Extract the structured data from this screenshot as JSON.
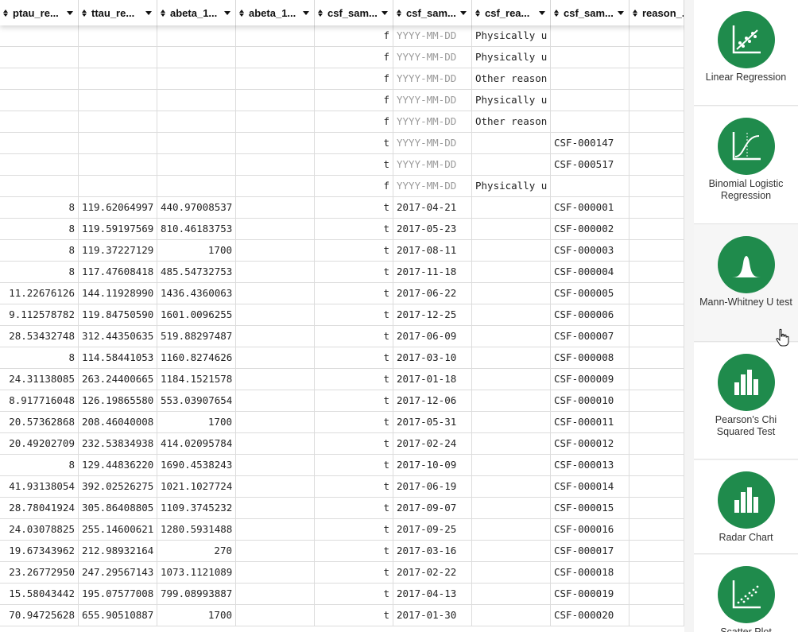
{
  "grid": {
    "columns": [
      {
        "label": "ptau_re..."
      },
      {
        "label": "ttau_re..."
      },
      {
        "label": "abeta_1..."
      },
      {
        "label": "abeta_1..."
      },
      {
        "label": "csf_sam..."
      },
      {
        "label": "csf_sam..."
      },
      {
        "label": "csf_rea..."
      },
      {
        "label": "csf_sam..."
      },
      {
        "label": "reason_..."
      }
    ],
    "date_placeholder": "YYYY-MM-DD",
    "rows": [
      [
        "",
        "",
        "",
        "",
        "f",
        "",
        "Physically u",
        "",
        ""
      ],
      [
        "",
        "",
        "",
        "",
        "f",
        "",
        "Physically u",
        "",
        ""
      ],
      [
        "",
        "",
        "",
        "",
        "f",
        "",
        "Other reason",
        "",
        ""
      ],
      [
        "",
        "",
        "",
        "",
        "f",
        "",
        "Physically u",
        "",
        ""
      ],
      [
        "",
        "",
        "",
        "",
        "f",
        "",
        "Other reason",
        "",
        ""
      ],
      [
        "",
        "",
        "",
        "",
        "t",
        "",
        "",
        "CSF-000147",
        ""
      ],
      [
        "",
        "",
        "",
        "",
        "t",
        "",
        "",
        "CSF-000517",
        ""
      ],
      [
        "",
        "",
        "",
        "",
        "f",
        "",
        "Physically u",
        "",
        ""
      ],
      [
        "8",
        "119.62064997",
        "440.97008537",
        "",
        "t",
        "2017-04-21",
        "",
        "CSF-000001",
        ""
      ],
      [
        "8",
        "119.59197569",
        "810.46183753",
        "",
        "t",
        "2017-05-23",
        "",
        "CSF-000002",
        ""
      ],
      [
        "8",
        "119.37227129",
        "1700",
        "",
        "t",
        "2017-08-11",
        "",
        "CSF-000003",
        ""
      ],
      [
        "8",
        "117.47608418",
        "485.54732753",
        "",
        "t",
        "2017-11-18",
        "",
        "CSF-000004",
        ""
      ],
      [
        "11.22676126",
        "144.11928990",
        "1436.4360063",
        "",
        "t",
        "2017-06-22",
        "",
        "CSF-000005",
        ""
      ],
      [
        "9.112578782",
        "119.84750590",
        "1601.0096255",
        "",
        "t",
        "2017-12-25",
        "",
        "CSF-000006",
        ""
      ],
      [
        "28.53432748",
        "312.44350635",
        "519.88297487",
        "",
        "t",
        "2017-06-09",
        "",
        "CSF-000007",
        ""
      ],
      [
        "8",
        "114.58441053",
        "1160.8274626",
        "",
        "t",
        "2017-03-10",
        "",
        "CSF-000008",
        ""
      ],
      [
        "24.31138085",
        "263.24400665",
        "1184.1521578",
        "",
        "t",
        "2017-01-18",
        "",
        "CSF-000009",
        ""
      ],
      [
        "8.917716048",
        "126.19865580",
        "553.03907654",
        "",
        "t",
        "2017-12-06",
        "",
        "CSF-000010",
        ""
      ],
      [
        "20.57362868",
        "208.46040008",
        "1700",
        "",
        "t",
        "2017-05-31",
        "",
        "CSF-000011",
        ""
      ],
      [
        "20.49202709",
        "232.53834938",
        "414.02095784",
        "",
        "t",
        "2017-02-24",
        "",
        "CSF-000012",
        ""
      ],
      [
        "8",
        "129.44836220",
        "1690.4538243",
        "",
        "t",
        "2017-10-09",
        "",
        "CSF-000013",
        ""
      ],
      [
        "41.93138054",
        "392.02526275",
        "1021.1027724",
        "",
        "t",
        "2017-06-19",
        "",
        "CSF-000014",
        ""
      ],
      [
        "28.78041924",
        "305.86408805",
        "1109.3745232",
        "",
        "t",
        "2017-09-07",
        "",
        "CSF-000015",
        ""
      ],
      [
        "24.03078825",
        "255.14600621",
        "1280.5931488",
        "",
        "t",
        "2017-09-25",
        "",
        "CSF-000016",
        ""
      ],
      [
        "19.67343962",
        "212.98932164",
        "270",
        "",
        "t",
        "2017-03-16",
        "",
        "CSF-000017",
        ""
      ],
      [
        "23.26772950",
        "247.29567143",
        "1073.1121089",
        "",
        "t",
        "2017-02-22",
        "",
        "CSF-000018",
        ""
      ],
      [
        "15.58043442",
        "195.07577008",
        "799.08993887",
        "",
        "t",
        "2017-04-13",
        "",
        "CSF-000019",
        ""
      ],
      [
        "70.94725628",
        "655.90510887",
        "1700",
        "",
        "t",
        "2017-01-30",
        "",
        "CSF-000020",
        ""
      ]
    ]
  },
  "analyses": [
    {
      "label": "Linear Regression",
      "icon": "linear-regression-icon"
    },
    {
      "label": "Binomial Logistic Regression",
      "icon": "logistic-regression-icon"
    },
    {
      "label": "Mann-Whitney U test",
      "icon": "bell-curve-icon"
    },
    {
      "label": "Pearson's Chi Squared Test",
      "icon": "bar-chart-icon"
    },
    {
      "label": "Radar Chart",
      "icon": "bar-chart-icon"
    },
    {
      "label": "Scatter Plot",
      "icon": "scatter-plot-icon"
    }
  ],
  "colors": {
    "accent": "#1f8b4c"
  }
}
